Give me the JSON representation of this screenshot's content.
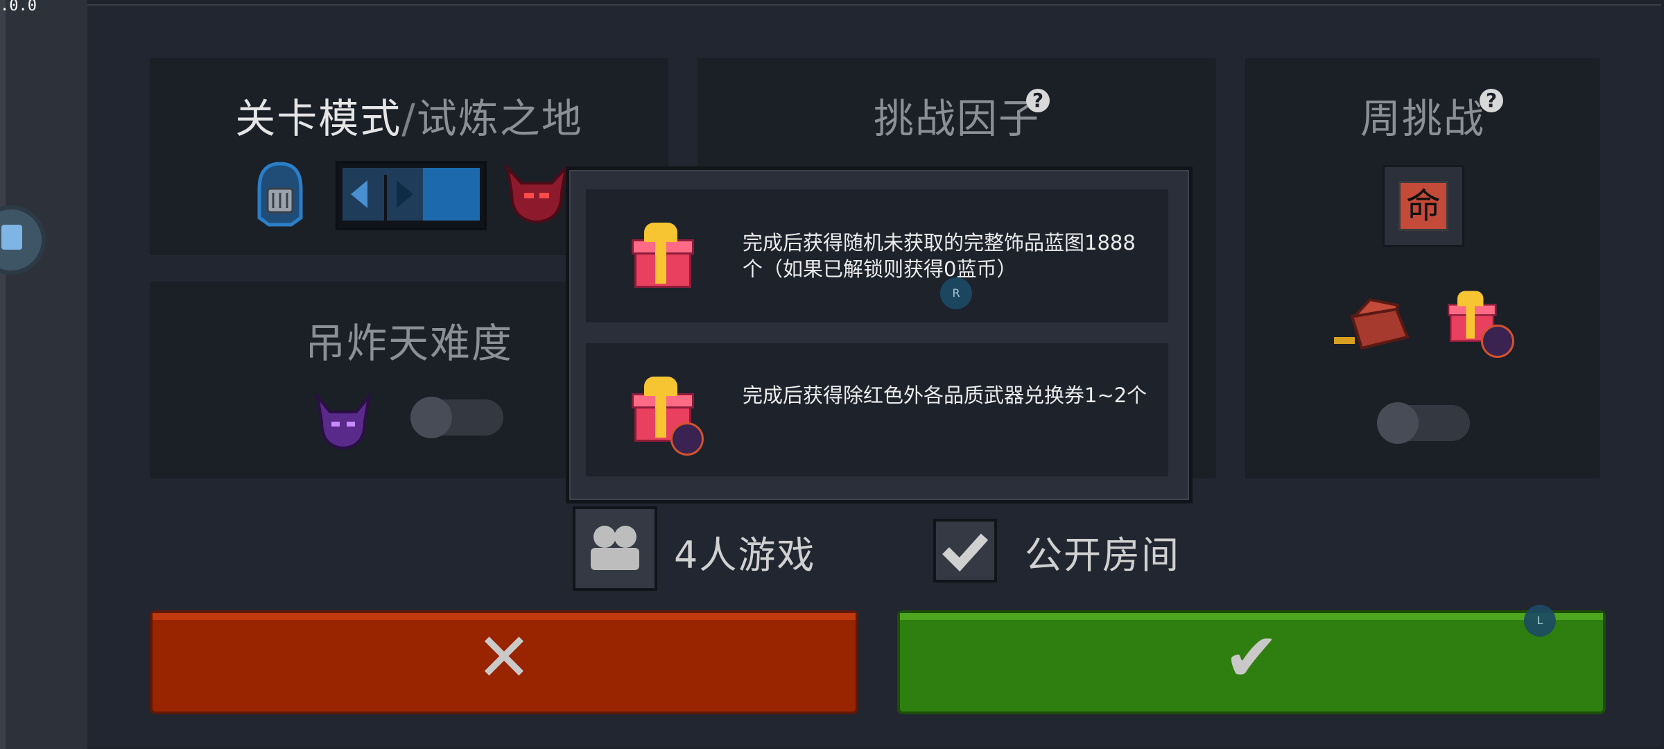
{
  "version": ".0.0",
  "level_panel": {
    "mode_label": "关卡模式",
    "separator": "/",
    "sub_mode_label": "试炼之地"
  },
  "difficulty_panel": {
    "title": "吊炸天难度"
  },
  "challenge_panel": {
    "title": "挑战因子"
  },
  "weekly_panel": {
    "title": "周挑战",
    "badge_glyph": "命"
  },
  "rewards": [
    {
      "text": "完成后获得随机未获取的完整饰品蓝图1888个（如果已解锁则获得0蓝币）"
    },
    {
      "text": "完成后获得除红色外各品质武器兑换券1~2个"
    }
  ],
  "players": {
    "label": "4人游戏"
  },
  "public_room": {
    "label": "公开房间",
    "checked": true
  },
  "hints": {
    "r": "R",
    "l": "L"
  },
  "buttons": {
    "cancel_glyph": "✕",
    "confirm_glyph": "✔"
  },
  "colors": {
    "cancel": "#982400",
    "confirm": "#2f7e10",
    "accent": "#1c6aad"
  }
}
